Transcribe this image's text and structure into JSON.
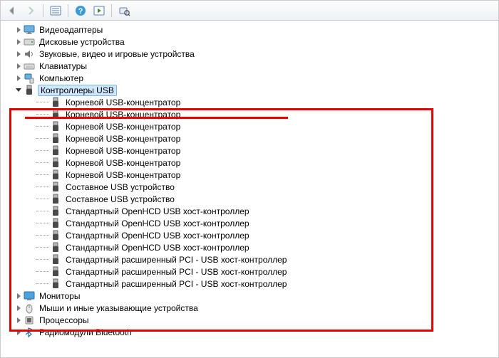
{
  "toolbar": {
    "back": "back",
    "forward": "forward",
    "show_hidden": "show-hidden",
    "help": "help",
    "action": "action",
    "scan": "scan-hardware"
  },
  "tree": {
    "top": [
      {
        "name": "video-adapters",
        "label": "Видеоадаптеры",
        "icon": "display"
      },
      {
        "name": "disk-drives",
        "label": "Дисковые устройства",
        "icon": "disk"
      },
      {
        "name": "sound-video-game",
        "label": "Звуковые, видео и игровые устройства",
        "icon": "speaker"
      },
      {
        "name": "keyboards",
        "label": "Клавиатуры",
        "icon": "keyboard"
      },
      {
        "name": "computer",
        "label": "Компьютер",
        "icon": "computer"
      }
    ],
    "usb": {
      "name": "usb-controllers",
      "label": "Контроллеры USB",
      "children": [
        {
          "label": "Корневой USB-концентратор"
        },
        {
          "label": "Корневой USB-концентратор"
        },
        {
          "label": "Корневой USB-концентратор"
        },
        {
          "label": "Корневой USB-концентратор"
        },
        {
          "label": "Корневой USB-концентратор"
        },
        {
          "label": "Корневой USB-концентратор"
        },
        {
          "label": "Корневой USB-концентратор"
        },
        {
          "label": "Составное USB устройство"
        },
        {
          "label": "Составное USB устройство"
        },
        {
          "label": "Стандартный OpenHCD USB хост-контроллер"
        },
        {
          "label": "Стандартный OpenHCD USB хост-контроллер"
        },
        {
          "label": "Стандартный OpenHCD USB хост-контроллер"
        },
        {
          "label": "Стандартный OpenHCD USB хост-контроллер"
        },
        {
          "label": "Стандартный расширенный PCI - USB хост-контроллер"
        },
        {
          "label": "Стандартный расширенный PCI - USB хост-контроллер"
        },
        {
          "label": "Стандартный расширенный PCI - USB хост-контроллер"
        }
      ]
    },
    "bottom": [
      {
        "name": "monitors",
        "label": "Мониторы",
        "icon": "monitor"
      },
      {
        "name": "mice",
        "label": "Мыши и иные указывающие устройства",
        "icon": "mouse"
      },
      {
        "name": "processors",
        "label": "Процессоры",
        "icon": "cpu"
      },
      {
        "name": "bluetooth",
        "label": "Радиомодули Bluetooth",
        "icon": "bluetooth"
      }
    ]
  }
}
